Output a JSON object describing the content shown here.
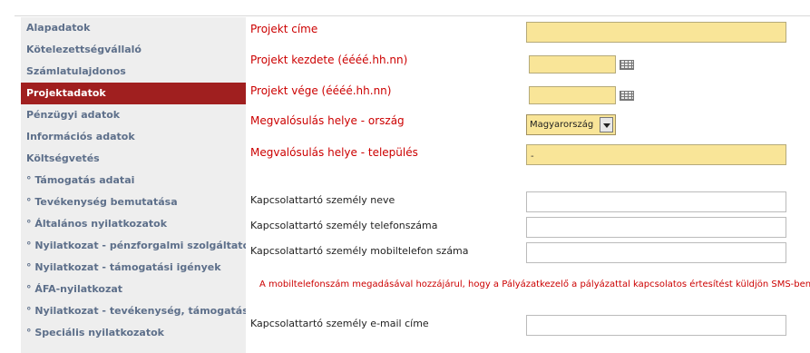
{
  "sidebar": {
    "items": [
      {
        "label": "Alapadatok"
      },
      {
        "label": "Kötelezettségvállaló"
      },
      {
        "label": "Számlatulajdonos"
      },
      {
        "label": "Projektadatok"
      },
      {
        "label": "Pénzügyi adatok"
      },
      {
        "label": "Információs adatok"
      },
      {
        "label": "Költségvetés"
      },
      {
        "label": "° Támogatás adatai"
      },
      {
        "label": "° Tevékenység bemutatása"
      },
      {
        "label": "° Általános nyilatkozatok"
      },
      {
        "label": "° Nyilatkozat - pénzforgalmi szolgáltatók"
      },
      {
        "label": "° Nyilatkozat - támogatási igények"
      },
      {
        "label": "° ÁFA-nyilatkozat"
      },
      {
        "label": "° Nyilatkozat - tevékenység, támogatás"
      },
      {
        "label": "° Speciális nyilatkozatok"
      }
    ],
    "active_index": 3
  },
  "form": {
    "projekt_cime": {
      "label": "Projekt címe",
      "value": ""
    },
    "projekt_kezdete": {
      "label": "Projekt kezdete (éééé.hh.nn)",
      "value": ""
    },
    "projekt_vege": {
      "label": "Projekt vége (éééé.hh.nn)",
      "value": ""
    },
    "orszag": {
      "label": "Megvalósulás helye - ország",
      "value": "Magyarország"
    },
    "telepules": {
      "label": "Megvalósulás helye - település",
      "value": "-"
    },
    "kapcs_nev": {
      "label": "Kapcsolattartó személy neve",
      "value": ""
    },
    "kapcs_telefon": {
      "label": "Kapcsolattartó személy telefonszáma",
      "value": ""
    },
    "kapcs_mobil": {
      "label": "Kapcsolattartó személy mobiltelefon száma",
      "value": ""
    },
    "mobil_note": "A mobiltelefonszám megadásával hozzájárul, hogy a Pályázatkezelő a pályázattal kapcsolatos értesítést küldjön SMS-ben",
    "kapcs_email": {
      "label": "Kapcsolattartó személy e-mail címe",
      "value": ""
    }
  },
  "colors": {
    "active_bg": "#a01f1f",
    "label_red": "#cc0000",
    "input_yellow": "#f9e598",
    "sidebar_text": "#5d6f8a"
  }
}
